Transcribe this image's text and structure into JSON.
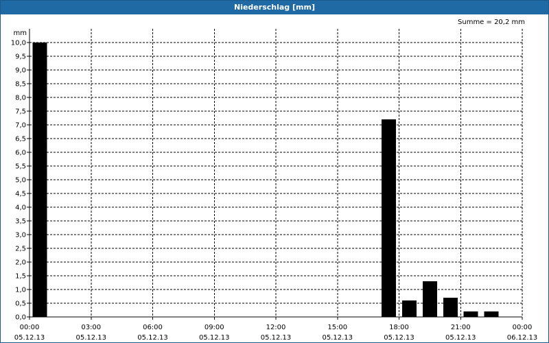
{
  "window": {
    "title": "Niederschlag [mm]"
  },
  "summary": {
    "sum_text": "Summe = 20,2 mm"
  },
  "colors": {
    "title_bar": "#1f6aa5",
    "bars": "#000000",
    "grid": "#000000"
  },
  "chart_data": {
    "type": "bar",
    "title": "Niederschlag [mm]",
    "ylabel": "mm",
    "xlabel": "",
    "ylim": [
      0,
      10
    ],
    "yticks": [
      "0,0",
      "0,5",
      "1,0",
      "1,5",
      "2,0",
      "2,5",
      "3,0",
      "3,5",
      "4,0",
      "4,5",
      "5,0",
      "5,5",
      "6,0",
      "6,5",
      "7,0",
      "7,5",
      "8,0",
      "8,5",
      "9,0",
      "9,5",
      "10,0"
    ],
    "xlim_hours": [
      0,
      24
    ],
    "xticks": [
      {
        "time": "00:00",
        "date": "05.12.13"
      },
      {
        "time": "03:00",
        "date": "05.12.13"
      },
      {
        "time": "06:00",
        "date": "05.12.13"
      },
      {
        "time": "09:00",
        "date": "05.12.13"
      },
      {
        "time": "12:00",
        "date": "05.12.13"
      },
      {
        "time": "15:00",
        "date": "05.12.13"
      },
      {
        "time": "18:00",
        "date": "05.12.13"
      },
      {
        "time": "21:00",
        "date": "05.12.13"
      },
      {
        "time": "00:00",
        "date": "06.12.13"
      }
    ],
    "grid": "dashed",
    "bars": [
      {
        "time": "00:00",
        "value": 10.0
      },
      {
        "time": "17:00",
        "value": 7.2
      },
      {
        "time": "18:00",
        "value": 0.6
      },
      {
        "time": "19:00",
        "value": 1.3
      },
      {
        "time": "20:00",
        "value": 0.7
      },
      {
        "time": "21:00",
        "value": 0.2
      },
      {
        "time": "22:00",
        "value": 0.2
      }
    ],
    "annotation": "Summe = 20,2 mm"
  }
}
